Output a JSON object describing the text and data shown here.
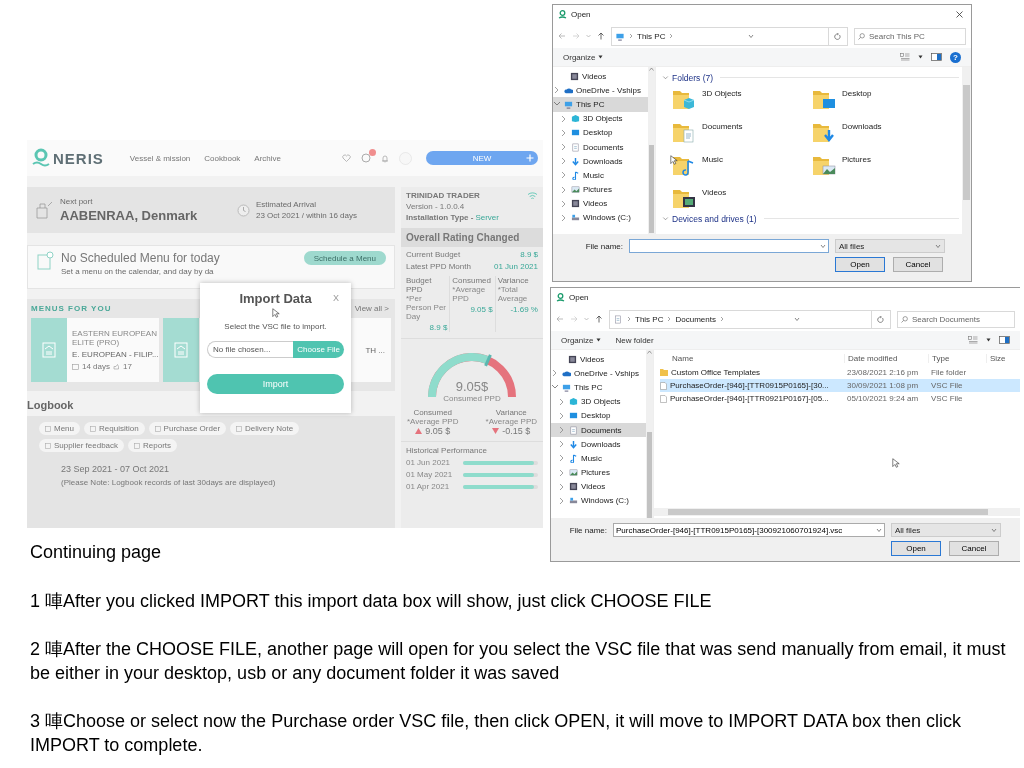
{
  "app": {
    "logo": "NERIS",
    "nav": [
      "Vessel & mission",
      "Cookbook",
      "Archive"
    ],
    "new_button": "NEW",
    "next_port": {
      "label": "Next port",
      "value": "AABENRAA, Denmark"
    },
    "arrival": {
      "label": "Estimated Arrival",
      "value": "23 Oct 2021 / within 16 days"
    },
    "menu_notice": {
      "title": "No Scheduled Menu for today",
      "text": "Set a menu on the calendar, and day by da",
      "button": "Schedule a Menu"
    },
    "menus": {
      "title": "MENUS FOR YOU",
      "view_all": "View all >",
      "cards": [
        {
          "tag": "EASTERN EUROPEAN ELITE (PRO)",
          "name": "E. EUROPEAN - FILIP...",
          "days": "14 days",
          "likes": "17"
        },
        {
          "name": "TH ..."
        }
      ]
    },
    "logbook": {
      "title": "Logbook",
      "filters": [
        "Menu",
        "Requisition",
        "Purchase Order",
        "Delivery Note",
        "Supplier feedback",
        "Reports"
      ],
      "range": "23 Sep 2021 - 07 Oct 2021",
      "note": "(Please Note: Logbook records of last 30days are displayed)"
    },
    "vessel": {
      "name": "TRINIDAD TRADER",
      "version": "Version - 1.0.0.4",
      "install_label": "Installation Type -",
      "install_value": "Server",
      "rating": "Overall Rating Changed",
      "budget": [
        {
          "label": "Current Budget",
          "value": "8.9 $"
        },
        {
          "label": "Latest PPD Month",
          "value": "01 Jun 2021"
        }
      ],
      "stats": [
        {
          "label": "Budget PPD",
          "sub": "*Per Person Per Day",
          "value": "8.9 $"
        },
        {
          "label": "Consumed",
          "sub": "*Average PPD",
          "value": "9.05 $"
        },
        {
          "label": "Variance",
          "sub": "*Total Average",
          "value": "-1.69 %"
        }
      ],
      "gauge": {
        "level": 0.7,
        "value": "9.05$",
        "label": "Consumed PPD"
      },
      "summary": [
        {
          "label": "Consumed",
          "sub": "*Average PPD",
          "value": "9.05 $",
          "kind": "increase"
        },
        {
          "label": "Variance",
          "sub": "*Average PPD",
          "value": "-0.15 $",
          "kind": "decrease"
        }
      ],
      "history": {
        "title": "Historical Performance",
        "rows": [
          {
            "month": "01 Jun 2021",
            "level": 0.95
          },
          {
            "month": "01 May 2021",
            "level": 0.95
          },
          {
            "month": "01 Apr 2021",
            "level": 0.95
          }
        ]
      }
    },
    "import_modal": {
      "title": "Import Data",
      "close": "X",
      "prompt": "Select the VSC file to import.",
      "file_field": {
        "placeholder": "No file chosen...",
        "button": "Choose File"
      },
      "import_button": "Import"
    }
  },
  "dialogs": [
    {
      "kind": "icons",
      "title": "Open",
      "close": true,
      "path": [
        "This PC"
      ],
      "search": {
        "placeholder": "Search This PC"
      },
      "commands": [
        "Organize"
      ],
      "help": "?",
      "nav": [
        {
          "label": "Videos",
          "selected": false
        },
        {
          "label": "OneDrive - Vships",
          "selected": false,
          "expanded": false
        },
        {
          "label": "This PC",
          "selected": true,
          "expanded": true,
          "children": [
            {
              "label": "3D Objects",
              "selected": false,
              "expanded": false
            },
            {
              "label": "Desktop",
              "selected": false,
              "expanded": false
            },
            {
              "label": "Documents",
              "selected": false,
              "expanded": false
            },
            {
              "label": "Downloads",
              "selected": false,
              "expanded": false
            },
            {
              "label": "Music",
              "selected": false,
              "expanded": false
            },
            {
              "label": "Pictures",
              "selected": false,
              "expanded": false
            },
            {
              "label": "Videos",
              "selected": false,
              "expanded": false
            },
            {
              "label": "Windows (C:)",
              "selected": false,
              "expanded": false
            }
          ]
        }
      ],
      "groups": [
        {
          "title": "Folders (7)",
          "expanded": true,
          "items": [
            "3D Objects",
            "Desktop",
            "Documents",
            "Downloads",
            "Music",
            "Pictures",
            "Videos"
          ]
        },
        {
          "title": "Devices and drives (1)",
          "expanded": true
        }
      ],
      "file_name_label": "File name:",
      "file_type": "All files",
      "buttons": [
        {
          "label": "Open",
          "default": true
        },
        {
          "label": "Cancel",
          "default": false
        }
      ]
    },
    {
      "kind": "details",
      "title": "Open",
      "close": false,
      "path": [
        "This PC",
        "Documents"
      ],
      "search": {
        "placeholder": "Search Documents"
      },
      "commands": [
        "Organize",
        "New folder"
      ],
      "nav": [
        {
          "label": "Videos",
          "selected": false
        },
        {
          "label": "OneDrive - Vships",
          "selected": false,
          "expanded": false
        },
        {
          "label": "This PC",
          "selected": false,
          "expanded": true,
          "children": [
            {
              "label": "3D Objects",
              "selected": false,
              "expanded": false
            },
            {
              "label": "Desktop",
              "selected": false,
              "expanded": false
            },
            {
              "label": "Documents",
              "selected": true,
              "expanded": false
            },
            {
              "label": "Downloads",
              "selected": false,
              "expanded": false
            },
            {
              "label": "Music",
              "selected": false,
              "expanded": false
            },
            {
              "label": "Pictures",
              "selected": false,
              "expanded": false
            },
            {
              "label": "Videos",
              "selected": false,
              "expanded": false
            },
            {
              "label": "Windows (C:)",
              "selected": false,
              "expanded": false
            }
          ]
        }
      ],
      "columns": [
        "Name",
        "Date modified",
        "Type",
        "Size"
      ],
      "rows": [
        {
          "kind": "folder",
          "name": "Custom Office Templates",
          "date": "23/08/2021 2:16 pm",
          "type": "File folder",
          "selected": false
        },
        {
          "kind": "file",
          "name": "PurchaseOrder-[946]-[TTR0915P0165]-[30...",
          "date": "30/09/2021 1:08 pm",
          "type": "VSC File",
          "selected": true
        },
        {
          "kind": "file",
          "name": "PurchaseOrder-[946]-[TTR0921P0167]-[05...",
          "date": "05/10/2021 9:24 am",
          "type": "VSC File",
          "selected": false
        }
      ],
      "file_name_label": "File name:",
      "file_name": "PurchaseOrder-[946]-[TTR0915P0165]-[300921060701924].vsc",
      "file_type": "All files",
      "buttons": [
        {
          "label": "Open",
          "default": true
        },
        {
          "label": "Cancel",
          "default": false
        }
      ]
    }
  ],
  "notes": {
    "heading": "Continuing page",
    "steps": [
      "1 唓After you clicked IMPORT this import data box will show, just click CHOOSE FILE",
      "2 唓After the CHOOSE FILE, another page will open for you select the VSC file that was send manually from email, it must be either in your desktop, usb or any document folder it was saved",
      "3 唓Choose or select now the Purchase order VSC file, then click OPEN, it will  move to IMPORT DATA box then click IMPORT to complete."
    ]
  }
}
